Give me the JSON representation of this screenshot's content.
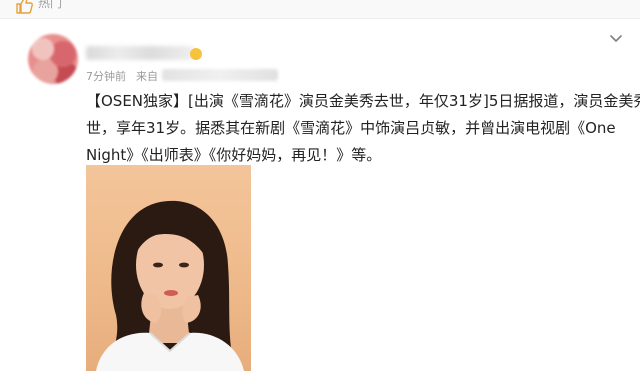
{
  "topbar": {
    "hot_label": "热门",
    "icon": "thumbs-up-outline-icon"
  },
  "post": {
    "time": "7分钟前",
    "source_label": "来自",
    "more_icon": "chevron-down-icon",
    "text_lines": [
      "【OSEN独家】[出演《雪滴花》演员金美秀去世，年仅31岁]5日据报道，演员金美秀去",
      "世，享年31岁。据悉其在新剧《雪滴花》中饰演吕贞敏，并曾出演电视剧《One",
      "Night》《出师表》《你好妈妈，再见！》等。"
    ]
  },
  "colors": {
    "photo_background": "#f3c59a",
    "badge": "#f7c23d",
    "meta_text": "#9a9a9a"
  }
}
